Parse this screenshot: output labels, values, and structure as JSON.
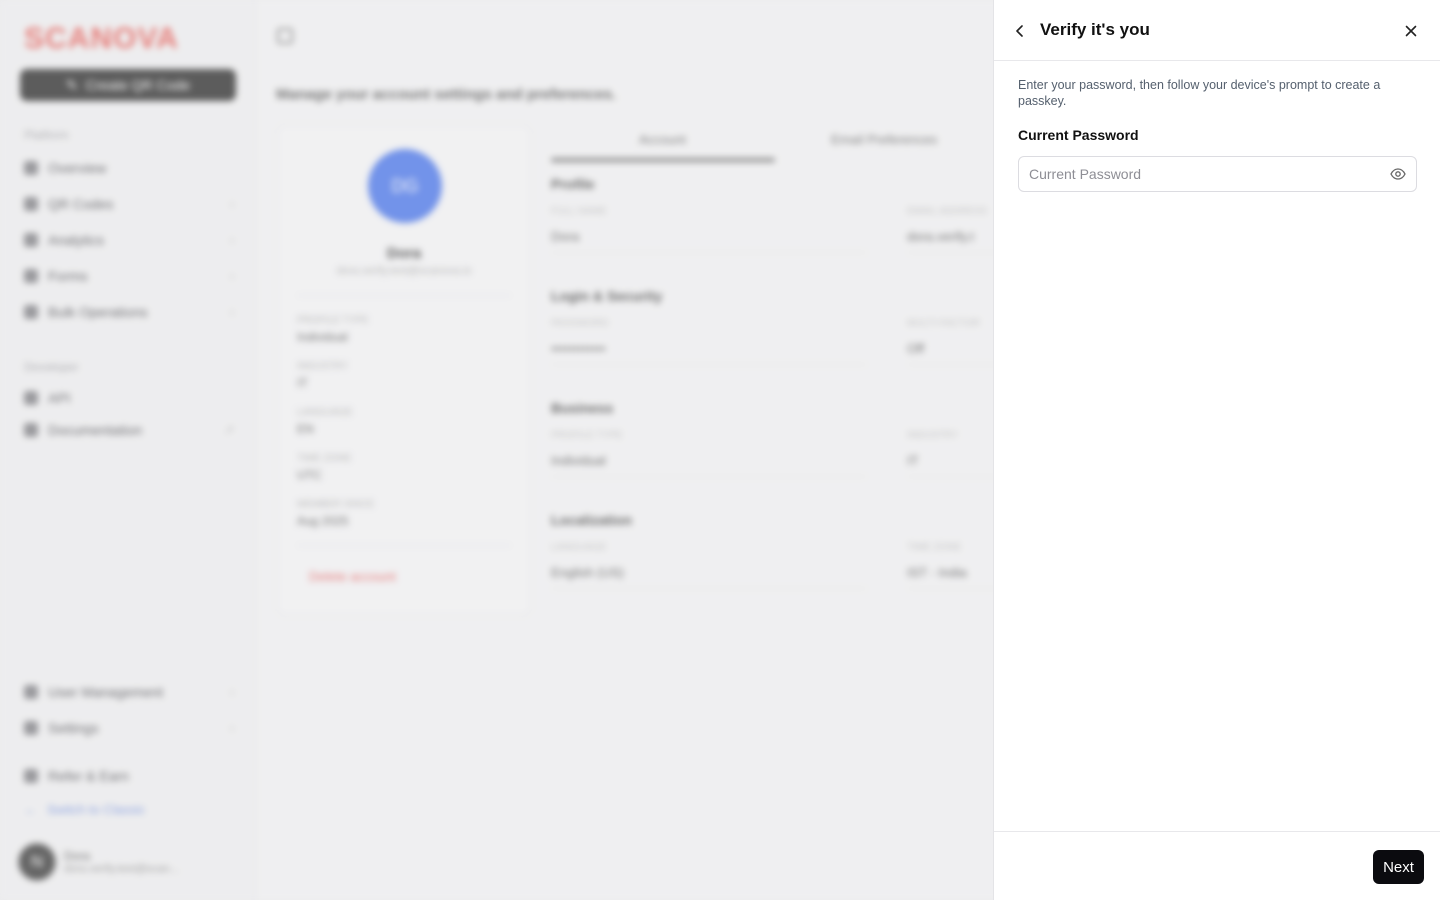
{
  "background": {
    "logo": "SCANOVA",
    "create_button": "Create QR Code",
    "sections": {
      "platform": "Platform",
      "developer": "Developer"
    },
    "nav": [
      "Overview",
      "QR Codes",
      "Analytics",
      "Forms",
      "Bulk Operations",
      "API",
      "Documentation",
      "User Management",
      "Settings",
      "Refer & Earn"
    ],
    "switch_link": "Switch to Classic",
    "user": {
      "initial": "N",
      "name": "Dora",
      "email": "dora.verify.test@scan..."
    },
    "page_subtitle": "Manage your account settings and preferences.",
    "profile": {
      "initials": "DG",
      "name": "Dora",
      "email": "dora.verify.test@scanova.io",
      "fields": [
        {
          "k": "PROFILE TYPE",
          "v": "Individual"
        },
        {
          "k": "INDUSTRY",
          "v": "IT"
        },
        {
          "k": "LANGUAGE",
          "v": "EN"
        },
        {
          "k": "TIME ZONE",
          "v": "UTC"
        },
        {
          "k": "MEMBER SINCE",
          "v": "Aug 2025"
        }
      ],
      "delete": "Delete account"
    },
    "tabs": [
      "Account",
      "Email Preferences"
    ],
    "section_titles": [
      "Profile",
      "Login & Security",
      "Business",
      "Localization"
    ],
    "form": [
      {
        "k": "FULL NAME",
        "v": "Dora"
      },
      {
        "k": "EMAIL ADDRESS",
        "v": "dora.verify.t"
      },
      {
        "k": "PASSWORD",
        "v": "••••••••••••"
      },
      {
        "k": "MULTI-FACTOR",
        "v": "Off"
      },
      {
        "k": "PROFILE TYPE",
        "v": "Individual"
      },
      {
        "k": "INDUSTRY",
        "v": "IT"
      },
      {
        "k": "LANGUAGE",
        "v": "English (US)"
      },
      {
        "k": "TIME ZONE",
        "v": "IST - India"
      }
    ]
  },
  "drawer": {
    "title": "Verify it's you",
    "description": "Enter your password, then follow your device's prompt to create a passkey.",
    "password_label": "Current Password",
    "password_placeholder": "Current Password",
    "password_value": "",
    "next_label": "Next"
  },
  "colors": {
    "brand": "#e0453f",
    "primary_button": "#0b0b0f",
    "avatar": "#2f61e6"
  },
  "icons": {
    "back": "chevron-left-icon",
    "close": "close-icon",
    "eye": "eye-icon"
  }
}
